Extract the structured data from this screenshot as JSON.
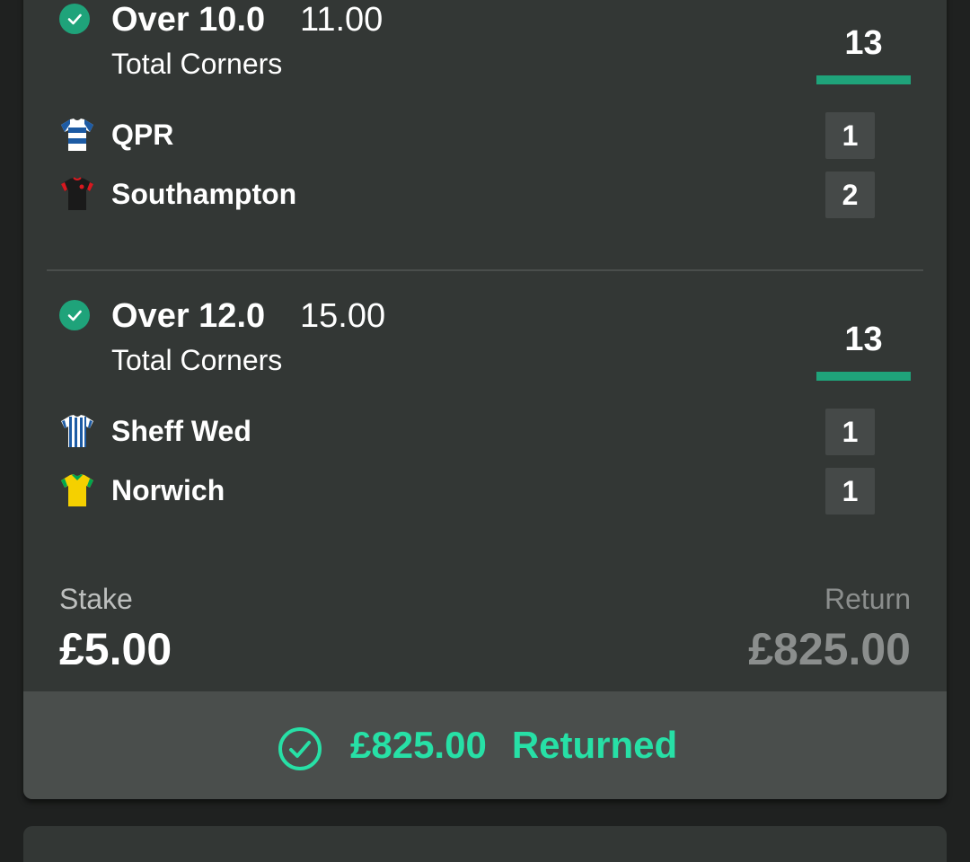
{
  "selections": [
    {
      "name": "Over 10.0",
      "odds": "11.00",
      "market": "Total Corners",
      "total": "13",
      "teams": [
        {
          "name": "QPR",
          "score": "1",
          "shirt": "qpr-shirt-icon"
        },
        {
          "name": "Southampton",
          "score": "2",
          "shirt": "southampton-shirt-icon"
        }
      ]
    },
    {
      "name": "Over 12.0",
      "odds": "15.00",
      "market": "Total Corners",
      "total": "13",
      "teams": [
        {
          "name": "Sheff Wed",
          "score": "1",
          "shirt": "sheff-wed-shirt-icon"
        },
        {
          "name": "Norwich",
          "score": "1",
          "shirt": "norwich-shirt-icon"
        }
      ]
    }
  ],
  "stake": {
    "label": "Stake",
    "value": "£5.00"
  },
  "return": {
    "label": "Return",
    "value": "£825.00"
  },
  "footer": {
    "amount": "£825.00",
    "label": "Returned",
    "icon": "check-circle-icon"
  },
  "colors": {
    "accent_green": "#1fa37a",
    "returned_text": "#27e0a6",
    "card_bg": "#333735",
    "footer_bg": "#4a4e4c",
    "page_bg": "#1f2120"
  }
}
